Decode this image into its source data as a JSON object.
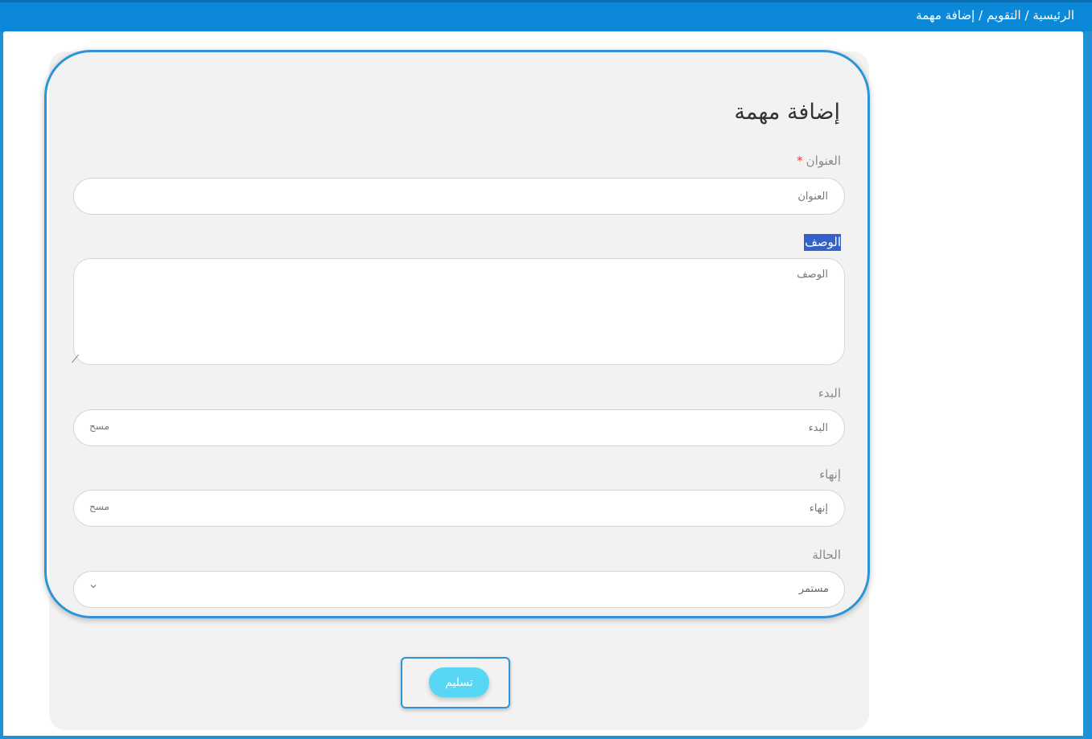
{
  "breadcrumb": {
    "home": "الرئيسية",
    "calendar": "التقويم",
    "current": "إضافة مهمة",
    "separator": "/"
  },
  "form": {
    "title": "إضافة مهمة",
    "title_field": {
      "label": "العنوان",
      "required_mark": "*",
      "placeholder": "العنوان"
    },
    "description_field": {
      "label": "الوصف",
      "placeholder": "الوصف"
    },
    "start_field": {
      "label": "البدء",
      "placeholder": "البدء",
      "clear": "مسح"
    },
    "end_field": {
      "label": "إنهاء",
      "placeholder": "إنهاء",
      "clear": "مسح"
    },
    "status_field": {
      "label": "الحالة",
      "selected": "مستمر"
    },
    "submit_label": "تسليم"
  },
  "icons": {
    "select_arrow": "chevron-down-icon"
  },
  "colors": {
    "topbar": "#0b88d8",
    "submit_button": "#58d7f4",
    "required": "#e53935",
    "selection": "#3362c9"
  }
}
